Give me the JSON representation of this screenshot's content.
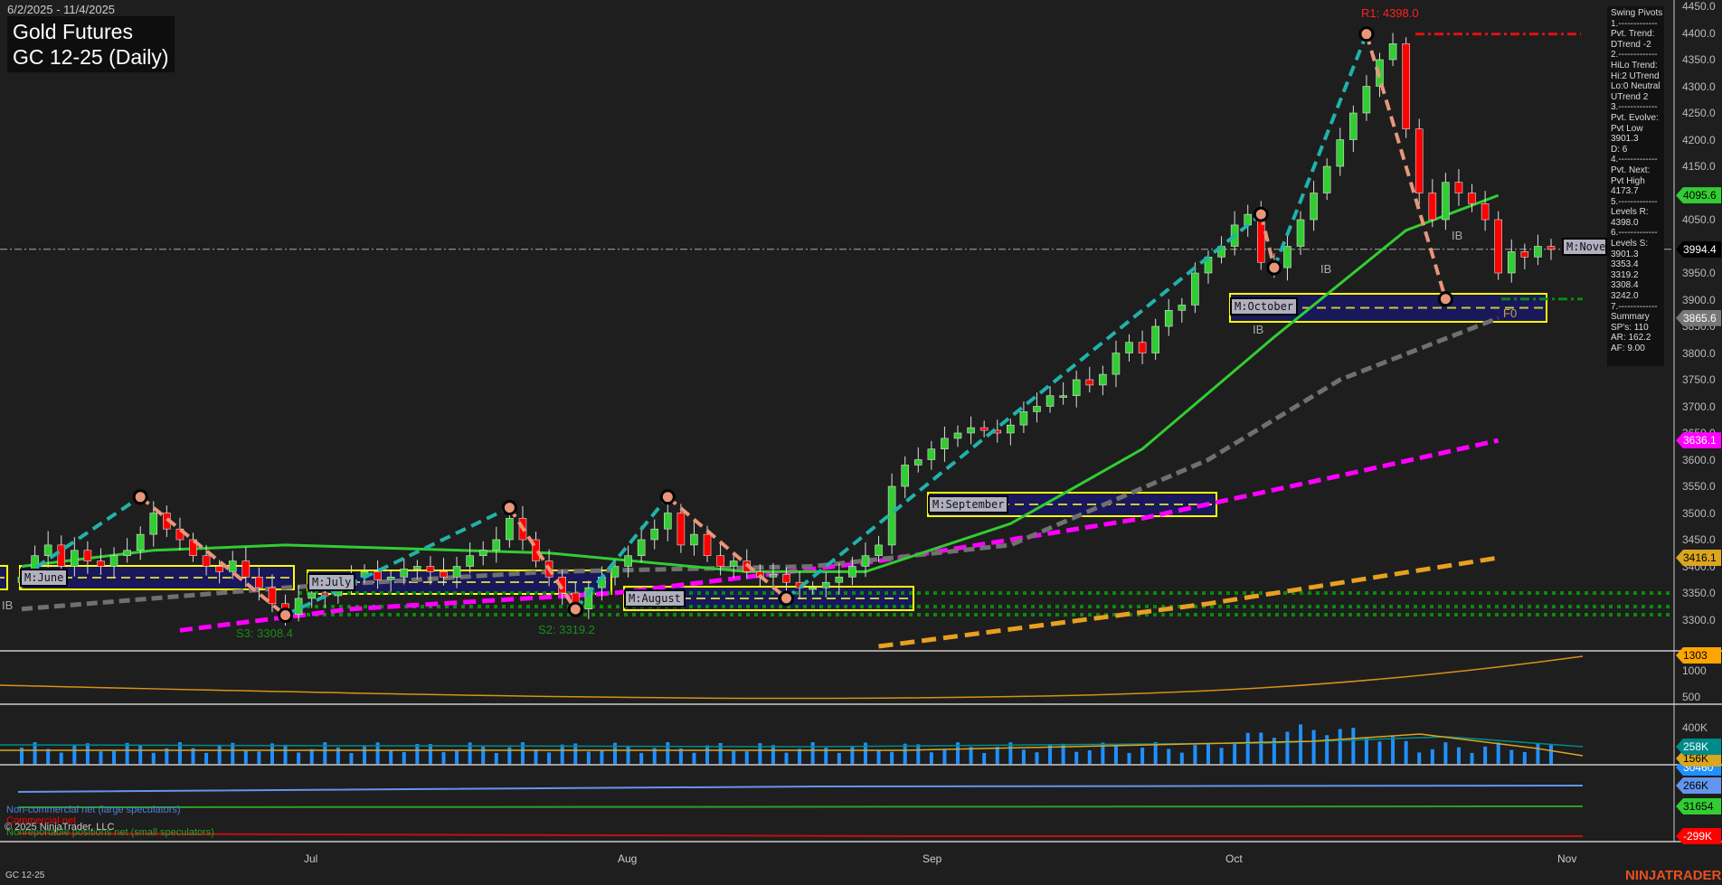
{
  "header": {
    "date_range": "6/2/2025 - 11/4/2025",
    "title": "Gold Futures",
    "subtitle": "GC 12-25 (Daily)"
  },
  "info_panel": [
    "Swing Pivots",
    "1.-------------",
    "Pvt. Trend:",
    "DTrend -2",
    "2.-------------",
    "HiLo Trend:",
    "Hi:2 UTrend",
    "Lo:0 Neutral",
    "UTrend 2",
    "3.-------------",
    "Pvt. Evolve:",
    "Pvt Low",
    "3901.3",
    "D: 6",
    "4.-------------",
    "Pvt. Next:",
    "Pvt High",
    "4173.7",
    "5.-------------",
    "Levels R:",
    "4398.0",
    "6.-------------",
    "Levels S:",
    "3901.3",
    "3353.4",
    "3319.2",
    "3308.4",
    "3242.0",
    "7.-------------",
    "Summary",
    "SP's: 110",
    "AR: 162.2",
    "AF: 9.00"
  ],
  "annotations": {
    "r1": "R1: 4398.0",
    "s3": "S3: 3308.4",
    "s2": "S2: 3319.2",
    "f0": "F0",
    "ib": "IB"
  },
  "month_boxes": [
    "M:June",
    "M:July",
    "M:August",
    "M:September",
    "M:October",
    "M:November"
  ],
  "price_axis": {
    "ticks": [
      "4450.0",
      "4400.0",
      "4350.0",
      "4300.0",
      "4250.0",
      "4200.0",
      "4150.0",
      "4100.0",
      "4050.0",
      "4000.0",
      "3950.0",
      "3900.0",
      "3850.0",
      "3800.0",
      "3750.0",
      "3700.0",
      "3650.0",
      "3600.0",
      "3550.0",
      "3500.0",
      "3450.0",
      "3400.0",
      "3350.0",
      "3300.0"
    ]
  },
  "price_tags": [
    {
      "v": "4095.6",
      "color": "#32cd32",
      "fg": "#000"
    },
    {
      "v": "3994.4",
      "color": "#000",
      "fg": "#fff"
    },
    {
      "v": "3865.6",
      "color": "#777",
      "fg": "#fff"
    },
    {
      "v": "3636.1",
      "color": "#ff00ff",
      "fg": "#fff"
    },
    {
      "v": "3416.1",
      "color": "#daa520",
      "fg": "#000"
    }
  ],
  "panel2": {
    "ticks": [
      "1000",
      "500"
    ],
    "tag": "1303"
  },
  "panel3": {
    "ticks": [
      "400K"
    ],
    "tags": [
      {
        "v": "258K",
        "color": "#008b8b",
        "fg": "#fff"
      },
      {
        "v": "156K",
        "color": "#daa520",
        "fg": "#000"
      },
      {
        "v": "30460",
        "color": "#1e90ff",
        "fg": "#fff"
      }
    ]
  },
  "panel4": {
    "tags": [
      {
        "v": "266K",
        "color": "#6495ed",
        "fg": "#000"
      },
      {
        "v": "31654",
        "color": "#32cd32",
        "fg": "#000"
      },
      {
        "v": "-299K",
        "color": "#ff0000",
        "fg": "#fff"
      }
    ],
    "legend": [
      "Non-commercial net (large speculators)",
      "Commercial net",
      "Nonreportable positions net (small speculators)"
    ],
    "copyright": "© 2025 NinjaTrader, LLC"
  },
  "x_axis": [
    "Jul",
    "Aug",
    "Sep",
    "Oct",
    "Nov"
  ],
  "footer": {
    "symbol": "GC 12-25",
    "logo": "NINJATRADER"
  },
  "colors": {
    "up": "#32cd32",
    "down": "#ff0000",
    "bg": "#1e1e1e"
  },
  "chart_data": {
    "type": "candlestick",
    "title": "Gold Futures GC 12-25 (Daily)",
    "ylim": [
      3250,
      4460
    ],
    "closes": [
      3380,
      3420,
      3440,
      3400,
      3430,
      3410,
      3400,
      3420,
      3430,
      3460,
      3500,
      3470,
      3450,
      3420,
      3400,
      3390,
      3410,
      3380,
      3360,
      3330,
      3310,
      3340,
      3350,
      3345,
      3370,
      3380,
      3390,
      3375,
      3380,
      3395,
      3400,
      3390,
      3380,
      3400,
      3420,
      3430,
      3450,
      3490,
      3450,
      3410,
      3380,
      3350,
      3320,
      3360,
      3380,
      3400,
      3420,
      3450,
      3470,
      3500,
      3440,
      3460,
      3420,
      3400,
      3410,
      3390,
      3380,
      3385,
      3370,
      3360,
      3360,
      3370,
      3380,
      3400,
      3420,
      3440,
      3550,
      3590,
      3600,
      3620,
      3640,
      3650,
      3660,
      3655,
      3650,
      3665,
      3690,
      3700,
      3720,
      3720,
      3750,
      3740,
      3760,
      3800,
      3820,
      3800,
      3850,
      3880,
      3890,
      3950,
      3980,
      4000,
      4040,
      4060,
      3970,
      3960,
      4000,
      4050,
      4100,
      4150,
      4200,
      4250,
      4300,
      4350,
      4380,
      4220,
      4100,
      4050,
      4120,
      4100,
      4080,
      4050,
      3950,
      3990,
      3980,
      4000,
      3994.4
    ],
    "sma_fast": [
      [
        0,
        3400
      ],
      [
        10,
        3430
      ],
      [
        20,
        3440
      ],
      [
        40,
        3425
      ],
      [
        55,
        3390
      ],
      [
        64,
        3390
      ],
      [
        75,
        3480
      ],
      [
        85,
        3620
      ],
      [
        95,
        3830
      ],
      [
        105,
        4030
      ],
      [
        112,
        4095.6
      ]
    ],
    "sma_mid": [
      [
        0,
        3320
      ],
      [
        20,
        3360
      ],
      [
        40,
        3390
      ],
      [
        60,
        3400
      ],
      [
        75,
        3440
      ],
      [
        90,
        3600
      ],
      [
        100,
        3750
      ],
      [
        112,
        3865.6
      ]
    ],
    "sma_slow": [
      [
        12,
        3280
      ],
      [
        25,
        3320
      ],
      [
        45,
        3350
      ],
      [
        65,
        3410
      ],
      [
        85,
        3490
      ],
      [
        100,
        3570
      ],
      [
        112,
        3636.1
      ]
    ],
    "sma_long": [
      [
        65,
        3250
      ],
      [
        90,
        3330
      ],
      [
        112,
        3416.1
      ]
    ],
    "pivots": [
      [
        0,
        3380
      ],
      [
        9,
        3530
      ],
      [
        20,
        3308.4
      ],
      [
        37,
        3510
      ],
      [
        42,
        3319.2
      ],
      [
        49,
        3530
      ],
      [
        58,
        3340
      ],
      [
        94,
        4060
      ],
      [
        95,
        3960
      ],
      [
        102,
        4398
      ],
      [
        108,
        3901.3
      ]
    ],
    "support_levels": [
      3353.4,
      3319.2,
      3308.4
    ],
    "resistance": 4398.0
  }
}
